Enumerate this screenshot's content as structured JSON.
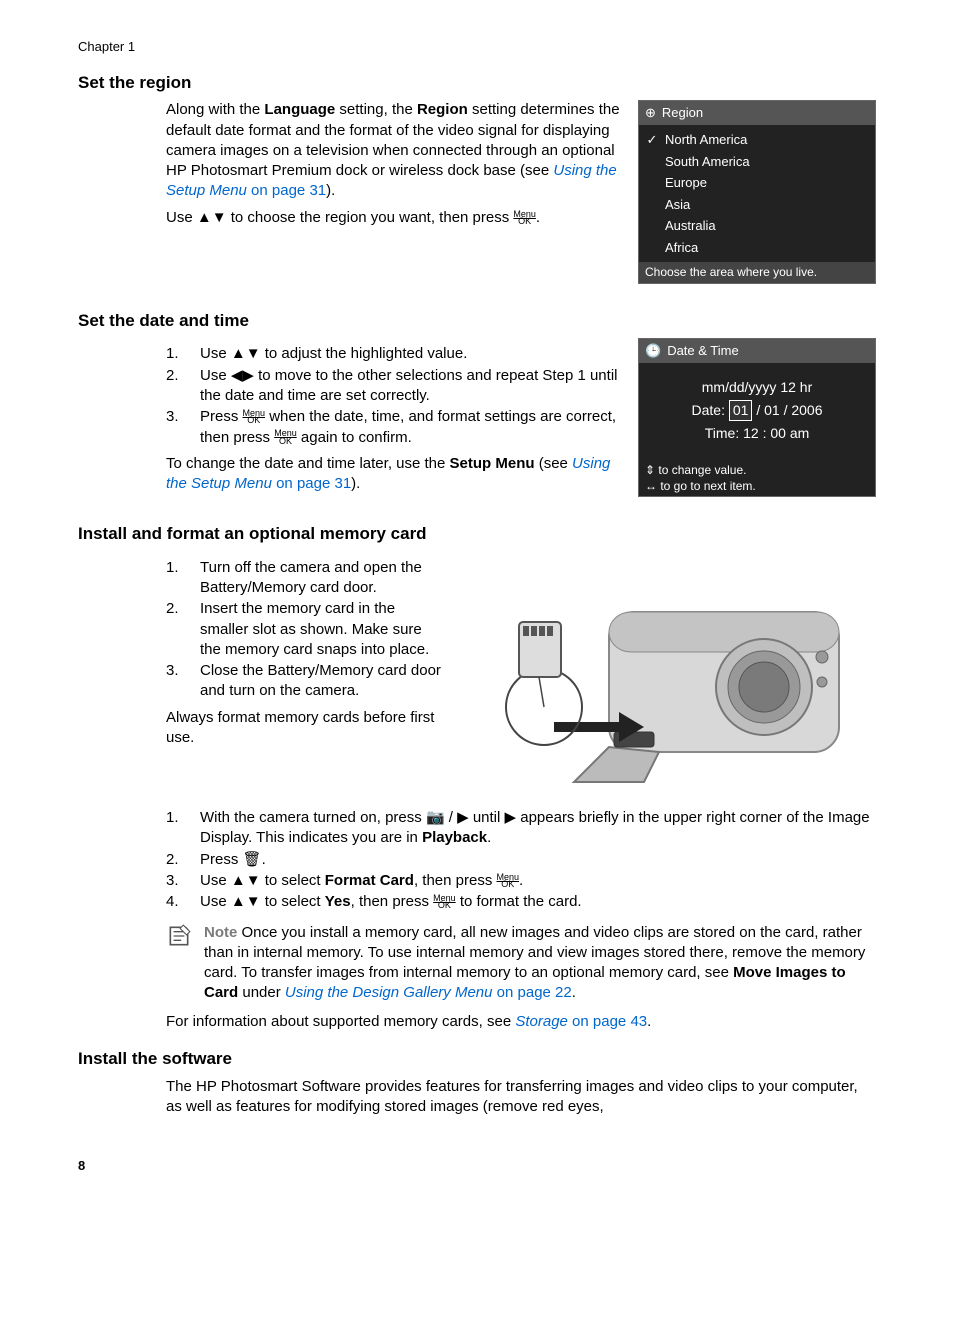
{
  "chapter": "Chapter 1",
  "page_number": "8",
  "sections": {
    "region": {
      "heading": "Set the region",
      "paragraph": {
        "pre": "Along with the ",
        "bold1": "Language",
        "mid1": " setting, the ",
        "bold2": "Region",
        "post": " setting determines the default date format and the format of the video signal for displaying camera images on a television when connected through an optional HP Photosmart Premium dock or wireless dock base (see ",
        "link": "Using the Setup Menu",
        "link_suffix": " on page 31",
        "end": ")."
      },
      "use_line": {
        "pre": "Use ",
        "post": " to choose the region you want, then press "
      },
      "period": "."
    },
    "datetime": {
      "heading": "Set the date and time",
      "step1": {
        "pre": "Use ",
        "post": " to adjust the highlighted value."
      },
      "step2": {
        "pre": "Use ",
        "post": " to move to the other selections and repeat Step 1 until the date and time are set correctly."
      },
      "step3": {
        "pre": "Press ",
        "mid": " when the date, time, and format settings are correct, then press ",
        "post": " again to confirm."
      },
      "after": {
        "pre": "To change the date and time later, use the ",
        "bold": "Setup Menu",
        "mid": " (see ",
        "link": "Using the Setup Menu",
        "link_suffix": " on page 31",
        "end": ")."
      }
    },
    "memcard": {
      "heading": "Install and format an optional memory card",
      "step1": "Turn off the camera and open the Battery/Memory card door.",
      "step2": "Insert the memory card in the smaller slot as shown. Make sure the memory card snaps into place.",
      "step3": "Close the Battery/Memory card door and turn on the camera.",
      "always": "Always format memory cards before first use.",
      "b1": {
        "pre": "With the camera turned on, press ",
        "mid": " until ",
        "post": " appears briefly in the upper right corner of the Image Display. This indicates you are in ",
        "bold": "Playback",
        "end": "."
      },
      "b2": {
        "pre": "Press ",
        "end": "."
      },
      "b3": {
        "pre": "Use ",
        "mid": " to select ",
        "bold": "Format Card",
        "mid2": ", then press ",
        "end": "."
      },
      "b4": {
        "pre": "Use ",
        "mid": " to select ",
        "bold": "Yes",
        "mid2": ", then press ",
        "post": " to format the card."
      },
      "note": {
        "label": "Note",
        "body1": "   Once you install a memory card, all new images and video clips are stored on the card, rather than in internal memory. To use internal memory and view images stored there, remove the memory card. To transfer images from internal memory to an optional memory card, see ",
        "bold": "Move Images to Card",
        "mid": " under ",
        "link": "Using the Design Gallery Menu",
        "link_suffix": " on page 22",
        "end": "."
      },
      "info": {
        "pre": "For information about supported memory cards, see ",
        "link": "Storage",
        "link_suffix": " on page 43",
        "end": "."
      }
    },
    "software": {
      "heading": "Install the software",
      "body": "The HP Photosmart Software provides features for transferring images and video clips to your computer, as well as features for modifying stored images (remove red eyes,"
    }
  },
  "screens": {
    "region": {
      "title": "Region",
      "items": [
        "North America",
        "South America",
        "Europe",
        "Asia",
        "Australia",
        "Africa"
      ],
      "selected_index": 0,
      "footer": "Choose the area where you live."
    },
    "datetime": {
      "title": "Date & Time",
      "format_line": "mm/dd/yyyy  12 hr",
      "date_label": "Date:",
      "date_month": "01",
      "date_rest": " / 01 / 2006",
      "time_label": "Time:",
      "time_value": "12 : 00  am",
      "footer1": "to change value.",
      "footer2": "to go to next item."
    }
  }
}
